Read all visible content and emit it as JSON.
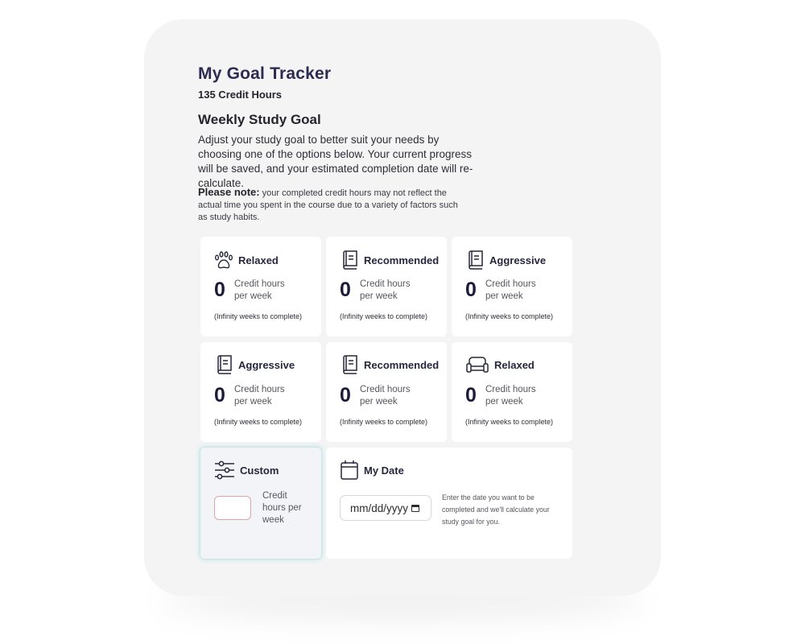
{
  "header": {
    "title": "My Goal Tracker",
    "subtitle": "135 Credit Hours",
    "section_title": "Weekly Study Goal",
    "description": "Adjust your study goal to better suit your needs by choosing one of the options below. Your current progress will be saved, and your estimated completion date will re-calculate.",
    "note_label": "Please note:",
    "note_text": " your completed credit hours may not reflect the actual time you spent in the course due to a variety of factors such as study habits."
  },
  "goal_options": [
    {
      "label": "Relaxed",
      "icon": "paw-icon",
      "value": "0",
      "unit": "Credit hours per week",
      "weeks": "(Infinity weeks to complete)"
    },
    {
      "label": "Recommended",
      "icon": "book-icon",
      "value": "0",
      "unit": "Credit hours per week",
      "weeks": "(Infinity weeks to complete)"
    },
    {
      "label": "Aggressive",
      "icon": "book-icon",
      "value": "0",
      "unit": "Credit hours per week",
      "weeks": "(Infinity weeks to complete)"
    },
    {
      "label": "Aggressive",
      "icon": "book-icon",
      "value": "0",
      "unit": "Credit hours per week",
      "weeks": "(Infinity weeks to complete)"
    },
    {
      "label": "Recommended",
      "icon": "book-icon",
      "value": "0",
      "unit": "Credit hours per week",
      "weeks": "(Infinity weeks to complete)"
    },
    {
      "label": "Relaxed",
      "icon": "couch-icon",
      "value": "0",
      "unit": "Credit hours per week",
      "weeks": "(Infinity weeks to complete)"
    }
  ],
  "custom": {
    "label": "Custom",
    "icon": "sliders-icon",
    "input_value": "",
    "unit": "Credit hours per week"
  },
  "my_date": {
    "label": "My Date",
    "icon": "calendar-icon",
    "placeholder": "mm/dd/yyyy",
    "help": "Enter the date you want to be completed and we'll calculate your study goal for you."
  },
  "colors": {
    "title": "#2c2c52",
    "custom_border": "#c6e6e8",
    "custom_input_border": "#e0a4a8"
  }
}
